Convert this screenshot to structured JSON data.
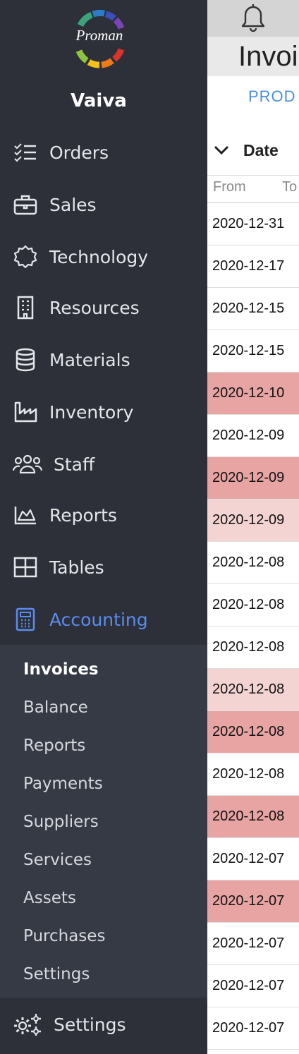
{
  "sidebar": {
    "logo_text": "Proman",
    "user_name": "Vaiva",
    "nav": [
      {
        "label": "Orders",
        "icon": "orders-list-icon"
      },
      {
        "label": "Sales",
        "icon": "briefcase-icon"
      },
      {
        "label": "Technology",
        "icon": "gear-outline-icon"
      },
      {
        "label": "Resources",
        "icon": "building-icon"
      },
      {
        "label": "Materials",
        "icon": "database-icon"
      },
      {
        "label": "Inventory",
        "icon": "factory-icon"
      },
      {
        "label": "Staff",
        "icon": "users-icon"
      },
      {
        "label": "Reports",
        "icon": "area-chart-icon"
      },
      {
        "label": "Tables",
        "icon": "table-icon"
      },
      {
        "label": "Accounting",
        "icon": "calculator-icon"
      }
    ],
    "submenu": [
      "Invoices",
      "Balance",
      "Reports",
      "Payments",
      "Suppliers",
      "Services",
      "Assets",
      "Purchases",
      "Settings"
    ],
    "settings_label": "Settings",
    "accent_color": "#5a8cf0"
  },
  "main": {
    "title": "Invoi",
    "tab_prod": "PROD",
    "column_header": "Date",
    "filter_from": "From",
    "filter_to": "To",
    "rows": [
      {
        "date": "2020-12-31",
        "highlight": "none"
      },
      {
        "date": "2020-12-17",
        "highlight": "none"
      },
      {
        "date": "2020-12-15",
        "highlight": "none"
      },
      {
        "date": "2020-12-15",
        "highlight": "none"
      },
      {
        "date": "2020-12-10",
        "highlight": "strong"
      },
      {
        "date": "2020-12-09",
        "highlight": "none"
      },
      {
        "date": "2020-12-09",
        "highlight": "strong"
      },
      {
        "date": "2020-12-09",
        "highlight": "light"
      },
      {
        "date": "2020-12-08",
        "highlight": "none"
      },
      {
        "date": "2020-12-08",
        "highlight": "none"
      },
      {
        "date": "2020-12-08",
        "highlight": "none"
      },
      {
        "date": "2020-12-08",
        "highlight": "light"
      },
      {
        "date": "2020-12-08",
        "highlight": "strong"
      },
      {
        "date": "2020-12-08",
        "highlight": "none"
      },
      {
        "date": "2020-12-08",
        "highlight": "strong"
      },
      {
        "date": "2020-12-07",
        "highlight": "none"
      },
      {
        "date": "2020-12-07",
        "highlight": "strong"
      },
      {
        "date": "2020-12-07",
        "highlight": "none"
      },
      {
        "date": "2020-12-07",
        "highlight": "none"
      },
      {
        "date": "2020-12-07",
        "highlight": "none"
      }
    ],
    "highlight_colors": {
      "strong": "#e8a3a3",
      "light": "#f4d3d3"
    }
  }
}
